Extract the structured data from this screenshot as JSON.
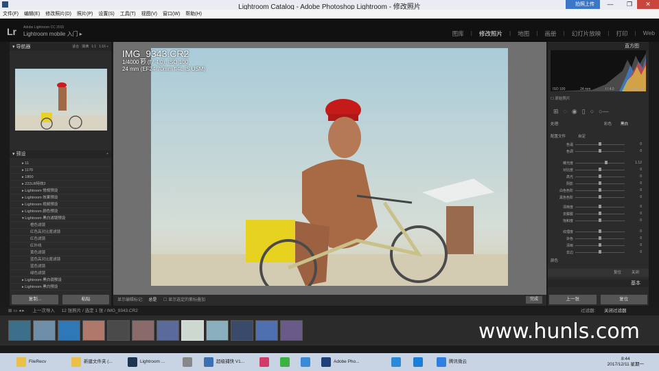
{
  "window": {
    "title": "Lightroom Catalog - Adobe Photoshop Lightroom - 修改照片",
    "cloud_label": "拍照上传"
  },
  "menu": [
    "文件(F)",
    "编辑(E)",
    "修改照片(D)",
    "照片(P)",
    "设置(S)",
    "工具(T)",
    "视图(V)",
    "窗口(W)",
    "帮助(H)"
  ],
  "lr": {
    "logo": "Lr",
    "version": "Adobe Lightroom CC 2015",
    "mobile": "Lightroom mobile 入门 ▸"
  },
  "modules": [
    "图库",
    "修改照片",
    "地图",
    "画册",
    "幻灯片放映",
    "打印",
    "Web"
  ],
  "active_module": "修改照片",
  "left": {
    "navigator": {
      "title": "导航器",
      "zoom": [
        "适合",
        "填满",
        "1:1",
        "1:16 ÷"
      ]
    },
    "presets_title": "预设",
    "presets": [
      {
        "label": "▸ 11",
        "sub": false
      },
      {
        "label": "▸ 1170",
        "sub": false
      },
      {
        "label": "▸ 1800",
        "sub": false
      },
      {
        "label": "▸ 222LR特效2",
        "sub": false
      },
      {
        "label": "▸ Lightroom 常规预设",
        "sub": false
      },
      {
        "label": "▸ Lightroom 效果预设",
        "sub": false
      },
      {
        "label": "▸ Lightroom 视频预设",
        "sub": false
      },
      {
        "label": "▸ Lightroom 颜色预设",
        "sub": false
      },
      {
        "label": "▾ Lightroom 黑白滤镜预设",
        "sub": false
      },
      {
        "label": "橙色滤镜",
        "sub": true
      },
      {
        "label": "红色高对比度滤镜",
        "sub": true
      },
      {
        "label": "红色滤镜",
        "sub": true
      },
      {
        "label": "红外线",
        "sub": true
      },
      {
        "label": "黄色滤镜",
        "sub": true
      },
      {
        "label": "蓝色高对比度滤镜",
        "sub": true
      },
      {
        "label": "蓝色滤镜",
        "sub": true
      },
      {
        "label": "绿色滤镜",
        "sub": true
      },
      {
        "label": "▸ Lightroom 黑白调预设",
        "sub": false
      },
      {
        "label": "▸ Lightroom 黑白预设",
        "sub": false
      }
    ],
    "copy_button": "复制...",
    "paste_button": "粘贴"
  },
  "photo_info": {
    "filename": "IMG_9343.CR2",
    "exposure": "1/4000 秒 (f / 4.0), ISO 100",
    "lens": "24 mm (EF24-70mm f/4L IS USM)"
  },
  "toolbar": {
    "label": "显示编辑标记:",
    "mode": "总是",
    "checkbox": "显示选定的紫标叠加",
    "done": "完成"
  },
  "right": {
    "histogram_title": "直方图",
    "hist_labels": [
      "ISO 100",
      "24 mm",
      "f / 4.0",
      "1/4000 秒"
    ],
    "original_label": "原始照片",
    "basic_header": [
      "处理:",
      "彩色",
      "黑白"
    ],
    "treatment": "基本",
    "profile_label": "配置文件",
    "profile_value": "自定",
    "sliders": [
      {
        "label": "色温",
        "val": "0",
        "pos": 0.5
      },
      {
        "label": "色调",
        "val": "0",
        "pos": 0.5
      },
      {
        "label": "曝光度",
        "val": "1.12",
        "pos": 0.62
      },
      {
        "label": "对比度",
        "val": "0",
        "pos": 0.5
      },
      {
        "label": "高光",
        "val": "0",
        "pos": 0.5
      },
      {
        "label": "阴影",
        "val": "0",
        "pos": 0.5
      },
      {
        "label": "白色色阶",
        "val": "0",
        "pos": 0.5
      },
      {
        "label": "黑色色阶",
        "val": "0",
        "pos": 0.5
      },
      {
        "label": "清晰度",
        "val": "0",
        "pos": 0.5
      },
      {
        "label": "去朦胧",
        "val": "0",
        "pos": 0.5
      },
      {
        "label": "饱和度",
        "val": "0",
        "pos": 0.5
      },
      {
        "label": "纹理度",
        "val": "0",
        "pos": 0.5
      },
      {
        "label": "杂色",
        "val": "0",
        "pos": 0.5
      },
      {
        "label": "清晰",
        "val": "0",
        "pos": 0.5
      },
      {
        "label": "去边",
        "val": "0",
        "pos": 0.5
      }
    ],
    "color_label": "颜色",
    "reset_label": "复位",
    "close_label": "关闭",
    "basic_section": "基本",
    "prev_button": "上一张",
    "reset_button": "复位"
  },
  "filmstrip": {
    "nav": "上一次导入",
    "info": "12 张照片 / 选定 1 张 / IMG_9343.CR2",
    "filter_label": "过滤器:",
    "filter_value": "关闭过滤器"
  },
  "watermark": "www.hunls.com",
  "taskbar": [
    {
      "label": "FileRecv",
      "color": "#e8c04a"
    },
    {
      "label": "新建文件夹 (...",
      "color": "#e8c04a"
    },
    {
      "label": "Lightroom ...",
      "color": "#1c3552"
    },
    {
      "label": "",
      "color": "#888"
    },
    {
      "label": "超级捕快 V1...",
      "color": "#3a6fb0"
    },
    {
      "label": "",
      "color": "#d23a6a"
    },
    {
      "label": "",
      "color": "#3cb043"
    },
    {
      "label": "",
      "color": "#3a8ad8"
    },
    {
      "label": "Adobe Pho...",
      "color": "#1e3f7a"
    },
    {
      "label": "",
      "color": "#2a8ad8"
    },
    {
      "label": "",
      "color": "#1a7fd8"
    },
    {
      "label": "腾讯微云",
      "color": "#2f7fe0"
    }
  ],
  "clock": {
    "time": "8:44",
    "date": "2017/12/11 星期一"
  }
}
